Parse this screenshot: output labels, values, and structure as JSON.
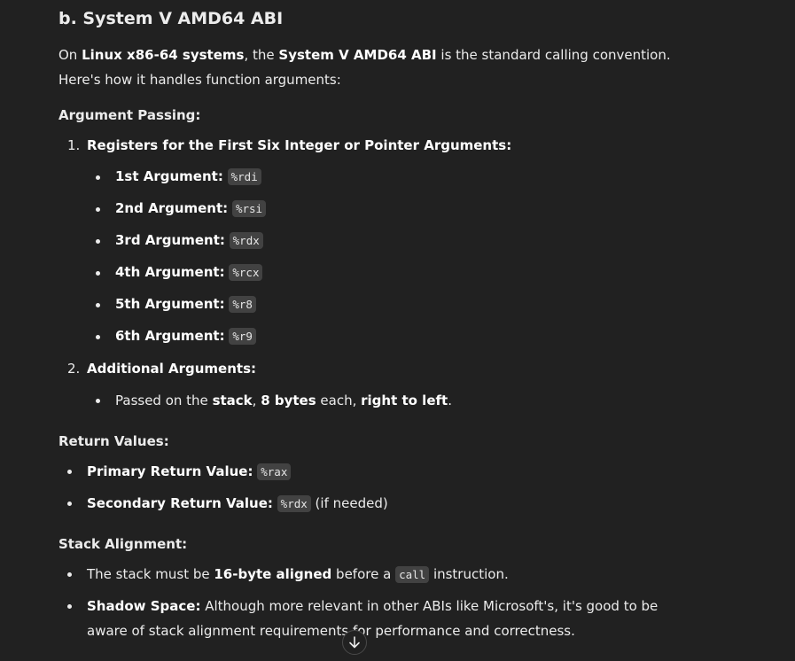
{
  "heading": "b. System V AMD64 ABI",
  "intro": {
    "t1": "On ",
    "b1": "Linux x86-64 systems",
    "t2": ", the ",
    "b2": "System V AMD64 ABI",
    "t3": " is the standard calling convention. Here's how it handles function arguments:"
  },
  "argument_passing": {
    "title": "Argument Passing:",
    "items": [
      {
        "num": "1.",
        "label": "Registers for the First Six Integer or Pointer Arguments:",
        "bullets": [
          {
            "label": "1st Argument:",
            "reg": "%rdi"
          },
          {
            "label": "2nd Argument:",
            "reg": "%rsi"
          },
          {
            "label": "3rd Argument:",
            "reg": "%rdx"
          },
          {
            "label": "4th Argument:",
            "reg": "%rcx"
          },
          {
            "label": "5th Argument:",
            "reg": "%r8"
          },
          {
            "label": "6th Argument:",
            "reg": "%r9"
          }
        ]
      },
      {
        "num": "2.",
        "label": "Additional Arguments:",
        "sub": {
          "t1": "Passed on the ",
          "b1": "stack",
          "t2": ", ",
          "b2": "8 bytes",
          "t3": " each, ",
          "b3": "right to left",
          "t4": "."
        }
      }
    ]
  },
  "return_values": {
    "title": "Return Values:",
    "primary": {
      "label": "Primary Return Value:",
      "reg": "%rax"
    },
    "secondary": {
      "label": "Secondary Return Value:",
      "reg": "%rdx",
      "note": " (if needed)"
    }
  },
  "stack_alignment": {
    "title": "Stack Alignment:",
    "item1": {
      "t1": "The stack must be ",
      "b1": "16-byte aligned",
      "t2": " before a ",
      "code": "call",
      "t3": " instruction."
    },
    "item2": {
      "b1": "Shadow Space:",
      "t1": " Although more relevant in other ABIs like Microsoft's, it's good to be aware of stack alignment requirements for performance and correctness."
    }
  },
  "scroll_button": {
    "icon": "arrow-down-icon"
  }
}
